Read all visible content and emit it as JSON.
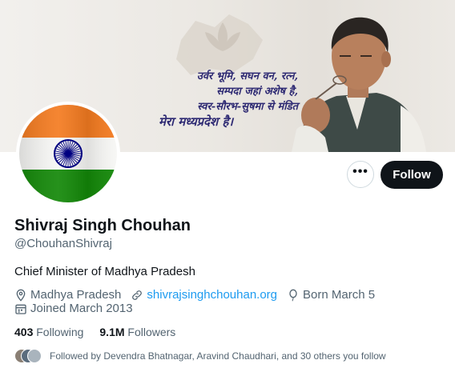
{
  "banner": {
    "poem_lines": [
      "उर्वर भूमि, सघन वन, रत्न,",
      "सम्पदा जहां अशेष है,",
      "स्वर-सौरभ-सुषमा से मंडित",
      "मेरा मध्यप्रदेश है।"
    ]
  },
  "profile": {
    "name": "Shivraj Singh Chouhan",
    "handle": "@ChouhanShivraj",
    "bio": "Chief Minister of Madhya Pradesh",
    "location": "Madhya Pradesh",
    "website": "shivrajsinghchouhan.org",
    "birthday": "Born March 5",
    "joined": "Joined March 2013"
  },
  "actions": {
    "more_label": "•••",
    "follow_label": "Follow"
  },
  "stats": {
    "following_count": "403",
    "following_label": "Following",
    "followers_count": "9.1M",
    "followers_label": "Followers"
  },
  "followed_by": {
    "text": "Followed by Devendra Bhatnagar, Aravind Chaudhari, and 30 others you follow"
  },
  "colors": {
    "accent_link": "#1d9bf0",
    "follow_button_bg": "#0f1419",
    "muted_text": "#536471",
    "flag_saffron": "#f47b20",
    "flag_green": "#138808",
    "chakra_blue": "#000080"
  }
}
